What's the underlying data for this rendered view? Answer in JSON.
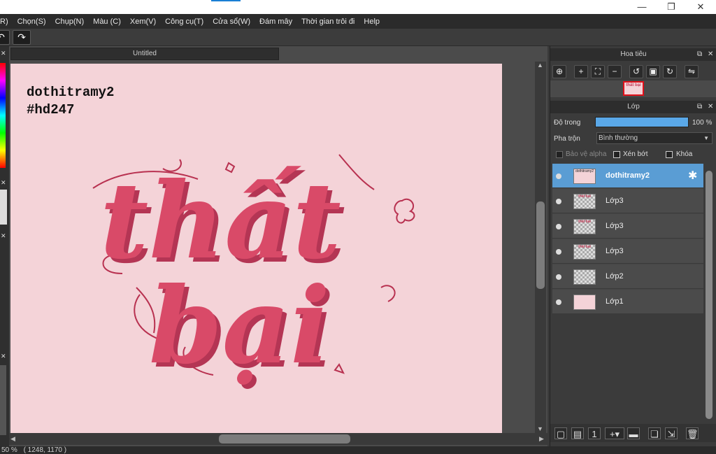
{
  "window": {
    "minimize": "—",
    "maximize": "❐",
    "close": "✕"
  },
  "menu": [
    "R)",
    "Chọn(S)",
    "Chụp(N)",
    "Màu (C)",
    "Xem(V)",
    "Công cụ(T)",
    "Cửa sổ(W)",
    "Đám mây",
    "Thời gian trôi đi",
    "Help"
  ],
  "toolbar": {
    "undo_icon": "↶",
    "redo_icon": "↷"
  },
  "document": {
    "tab_title": "Untitled",
    "watermark_line1": "dothitramy2",
    "watermark_line2": "#hd247",
    "artwork_line1": "thất",
    "artwork_line2": "bại",
    "artwork_color": "#d94a68"
  },
  "status": {
    "zoom": "50 %",
    "coords": "( 1248, 1170 )"
  },
  "navigator": {
    "title": "Hoa tiêu",
    "buttons": [
      "zoom-fit-icon",
      "zoom-in-icon",
      "fit-window-icon",
      "zoom-out-icon",
      "rotate-left-icon",
      "actual-size-icon",
      "rotate-right-icon",
      "flip-icon"
    ],
    "thumb_text": "thất bại"
  },
  "layers_panel": {
    "title": "Lớp",
    "opacity_label": "Độ trong",
    "opacity_value": "100 %",
    "opacity_fraction": 1.0,
    "blend_label": "Pha trộn",
    "blend_value": "Bình thường",
    "protect_alpha": "Bảo vệ alpha",
    "clipping": "Xén bớt",
    "lock": "Khóa",
    "layers": [
      {
        "name": "dothitramy2",
        "selected": true,
        "thumb": "text"
      },
      {
        "name": "Lớp3",
        "selected": false,
        "thumb": "art"
      },
      {
        "name": "Lớp3",
        "selected": false,
        "thumb": "art"
      },
      {
        "name": "Lớp3",
        "selected": false,
        "thumb": "art"
      },
      {
        "name": "Lớp2",
        "selected": false,
        "thumb": "empty"
      },
      {
        "name": "Lớp1",
        "selected": false,
        "thumb": "pink"
      }
    ],
    "gear_icon": "✱"
  },
  "colors": {
    "accent": "#5a9dd4",
    "canvas_bg": "#f4d3d8",
    "art": "#d94a68"
  }
}
